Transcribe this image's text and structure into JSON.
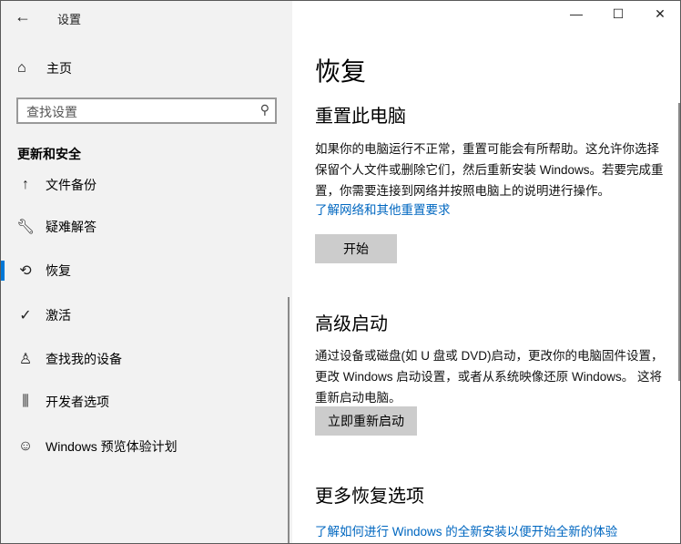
{
  "title": "设置",
  "sidebar": {
    "home": "主页",
    "search_placeholder": "查找设置",
    "section": "更新和安全",
    "items": [
      {
        "label": "文件备份",
        "icon": "backup-icon"
      },
      {
        "label": "疑难解答",
        "icon": "wrench-icon"
      },
      {
        "label": "恢复",
        "icon": "recovery-icon",
        "selected": true
      },
      {
        "label": "激活",
        "icon": "check-circle-icon"
      },
      {
        "label": "查找我的设备",
        "icon": "find-device-icon"
      },
      {
        "label": "开发者选项",
        "icon": "developer-icon"
      },
      {
        "label": "Windows 预览体验计划",
        "icon": "insider-icon"
      }
    ]
  },
  "main": {
    "title": "恢复",
    "reset": {
      "heading": "重置此电脑",
      "desc": "如果你的电脑运行不正常，重置可能会有所帮助。这允许你选择保留个人文件或删除它们，然后重新安装 Windows。若要完成重置，你需要连接到网络并按照电脑上的说明进行操作。",
      "link": "了解网络和其他重置要求",
      "button": "开始"
    },
    "advanced": {
      "heading": "高级启动",
      "desc": "通过设备或磁盘(如 U 盘或 DVD)启动，更改你的电脑固件设置，更改 Windows 启动设置，或者从系统映像还原 Windows。 这将重新启动电脑。",
      "button": "立即重新启动"
    },
    "more": {
      "heading": "更多恢复选项",
      "link": "了解如何进行 Windows 的全新安装以便开始全新的体验"
    }
  },
  "accent": "#0078d7"
}
